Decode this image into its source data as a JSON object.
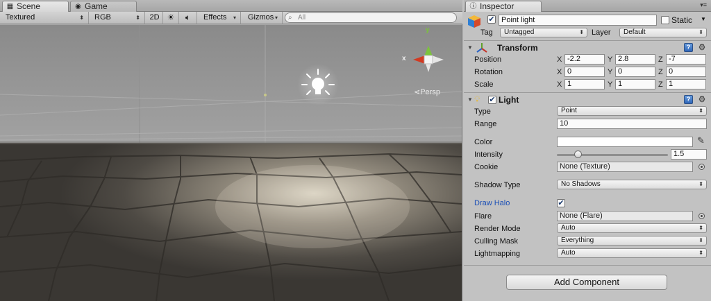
{
  "scene_tabs": [
    {
      "label": "Scene",
      "icon": "scene-icon"
    },
    {
      "label": "Game",
      "icon": "game-controller-icon"
    }
  ],
  "scene_toolbar": {
    "render_mode": "Textured",
    "color_mode": "RGB",
    "toggle_2d": "2D",
    "lighting_icon": "sun-icon",
    "audio_icon": "speaker-icon",
    "effects_label": "Effects",
    "gizmos_label": "Gizmos",
    "search_placeholder": "All"
  },
  "viewport": {
    "gizmo_axes": [
      "y",
      "x"
    ],
    "projection_label": "Persp",
    "light_icon": "point-light-icon"
  },
  "inspector": {
    "tab_label": "Inspector",
    "tab_icon": "info-icon",
    "object_icon": "gameobject-cube-icon",
    "object_active": true,
    "object_name": "Point light",
    "static_label": "Static",
    "static_checked": false,
    "tag_label": "Tag",
    "tag_value": "Untagged",
    "layer_label": "Layer",
    "layer_value": "Default",
    "transform": {
      "title": "Transform",
      "icon": "transform-axes-icon",
      "rows": [
        {
          "label": "Position",
          "x": "-2.2",
          "y": "2.8",
          "z": "-7"
        },
        {
          "label": "Rotation",
          "x": "0",
          "y": "0",
          "z": "0"
        },
        {
          "label": "Scale",
          "x": "1",
          "y": "1",
          "z": "1"
        }
      ],
      "axis_x": "X",
      "axis_y": "Y",
      "axis_z": "Z"
    },
    "light": {
      "title": "Light",
      "icon": "bulb-icon",
      "enabled": true,
      "type_label": "Type",
      "type_value": "Point",
      "range_label": "Range",
      "range_value": "10",
      "color_label": "Color",
      "color_value": "#ffffff",
      "intensity_label": "Intensity",
      "intensity_value": "1.5",
      "intensity_fraction": 0.19,
      "cookie_label": "Cookie",
      "cookie_value": "None (Texture)",
      "shadow_label": "Shadow Type",
      "shadow_value": "No Shadows",
      "halo_label": "Draw Halo",
      "halo_checked": true,
      "flare_label": "Flare",
      "flare_value": "None (Flare)",
      "render_mode_label": "Render Mode",
      "render_mode_value": "Auto",
      "culling_label": "Culling Mask",
      "culling_value": "Everything",
      "lightmapping_label": "Lightmapping",
      "lightmapping_value": "Auto"
    },
    "add_component_label": "Add Component"
  },
  "colors": {
    "halo_label_blue": "#1b4fb6",
    "gizmo_y": "#7cc33c",
    "gizmo_x": "#d23a22"
  }
}
